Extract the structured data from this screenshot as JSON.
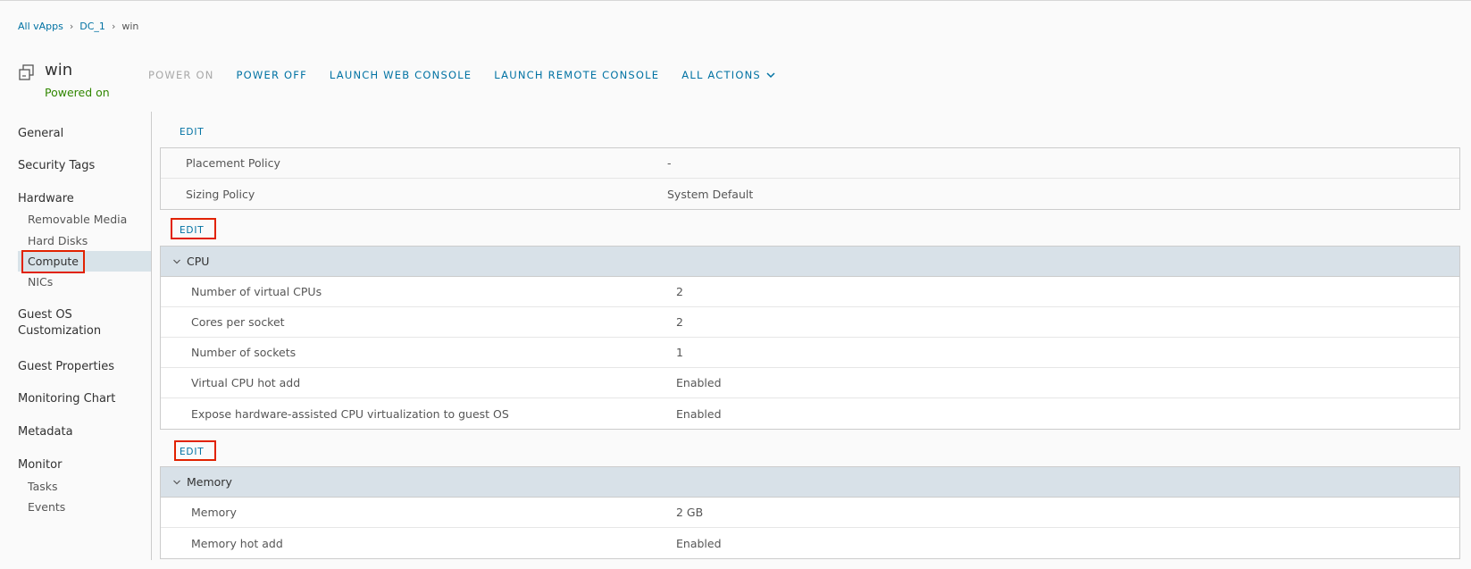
{
  "breadcrumb": {
    "item1": "All vApps",
    "item2": "DC_1",
    "item3": "win"
  },
  "vm": {
    "name": "win",
    "status": "Powered on"
  },
  "actions": {
    "power_on": "POWER ON",
    "power_off": "POWER OFF",
    "launch_web_console": "LAUNCH WEB CONSOLE",
    "launch_remote_console": "LAUNCH REMOTE CONSOLE",
    "all_actions": "ALL ACTIONS"
  },
  "sidebar": {
    "general": "General",
    "security_tags": "Security Tags",
    "hardware": "Hardware",
    "removable_media": "Removable Media",
    "hard_disks": "Hard Disks",
    "compute": "Compute",
    "nics": "NICs",
    "guest_os_line1": "Guest OS",
    "guest_os_line2": "Customization",
    "guest_properties": "Guest Properties",
    "monitoring_chart": "Monitoring Chart",
    "metadata": "Metadata",
    "monitor": "Monitor",
    "tasks": "Tasks",
    "events": "Events"
  },
  "edit_label": "EDIT",
  "policy": {
    "rows": [
      {
        "label": "Placement Policy",
        "value": "-"
      },
      {
        "label": "Sizing Policy",
        "value": "System Default"
      }
    ]
  },
  "cpu": {
    "header": "CPU",
    "rows": [
      {
        "label": "Number of virtual CPUs",
        "value": "2"
      },
      {
        "label": "Cores per socket",
        "value": "2"
      },
      {
        "label": "Number of sockets",
        "value": "1"
      },
      {
        "label": "Virtual CPU hot add",
        "value": "Enabled"
      },
      {
        "label": "Expose hardware-assisted CPU virtualization to guest OS",
        "value": "Enabled"
      }
    ]
  },
  "memory": {
    "header": "Memory",
    "rows": [
      {
        "label": "Memory",
        "value": "2 GB"
      },
      {
        "label": "Memory hot add",
        "value": "Enabled"
      }
    ]
  },
  "colors": {
    "accent": "#0072a3",
    "status_ok": "#318700",
    "highlight_box": "#e12200",
    "section_header": "#d8e1e8"
  }
}
